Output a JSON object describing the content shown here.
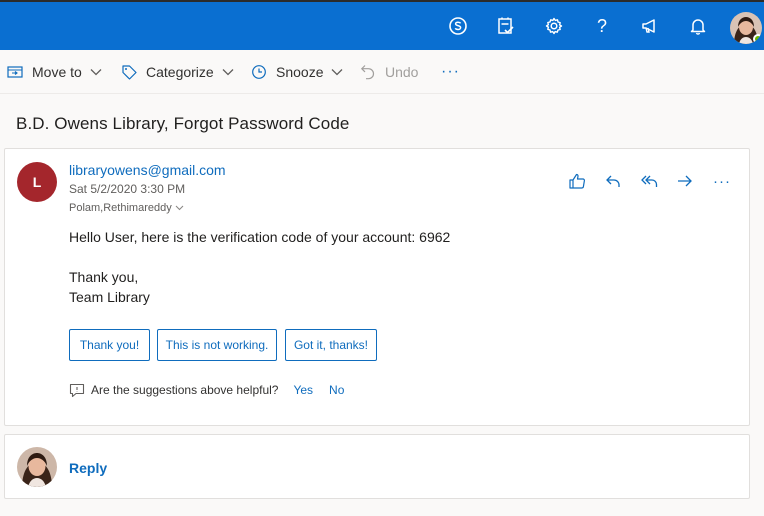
{
  "header": {
    "icons": [
      "skype-icon",
      "tasks-icon",
      "settings-gear-icon",
      "help-icon",
      "megaphone-icon",
      "bell-icon"
    ],
    "help_glyph": "?"
  },
  "toolbar": {
    "move_to": "Move to",
    "categorize": "Categorize",
    "snooze": "Snooze",
    "undo": "Undo",
    "more": "···"
  },
  "message": {
    "subject": "B.D. Owens Library, Forgot Password Code",
    "avatar_initial": "L",
    "sender": "libraryowens@gmail.com",
    "date": "Sat 5/2/2020 3:30 PM",
    "to": "Polam,Rethimareddy",
    "more": "···",
    "body": {
      "line1": "Hello User, here is the verification code of your account: 6962",
      "line2": "Thank you,",
      "line3": "Team Library"
    },
    "suggestions": [
      "Thank you!",
      "This is not working.",
      "Got it, thanks!"
    ],
    "feedback": {
      "question": "Are the suggestions above helpful?",
      "yes": "Yes",
      "no": "No"
    }
  },
  "reply": {
    "label": "Reply"
  },
  "colors": {
    "header_bg": "#0a6fd1",
    "accent": "#0f6cbd",
    "avatar_bg": "#a4262c",
    "presence": "#6bb700"
  }
}
